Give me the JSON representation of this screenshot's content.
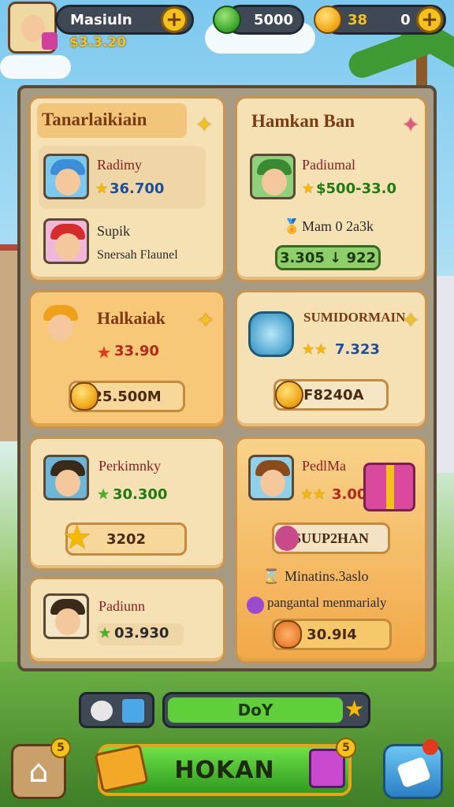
{
  "topbar": {
    "player_name": "Masiuln",
    "player_coins": "$3.3.20",
    "gems": "5000",
    "coins": "38",
    "coins_extra": "0"
  },
  "cards": {
    "c1": {
      "title": "Tanarlaikiain",
      "row1_name": "Radimy",
      "row1_value": "36.700",
      "row2_name": "Supik",
      "row2_desc": "Snersah Flaunel"
    },
    "c2": {
      "title": "Hamkan Ban",
      "row1_name": "Padiumal",
      "row1_value": "$500-33.0",
      "sub_label": "Mam 0 2a3k",
      "bar_value": "3.305 ↓ 922"
    },
    "c3": {
      "title": "Halkaiak",
      "value": "33.90",
      "bar_value": "25.500M"
    },
    "c4": {
      "title": "SUMIDORMAIN",
      "value": "7.323",
      "bar_value": "IF8240A"
    },
    "c5": {
      "title": "Perkimnky",
      "value": "30.300",
      "bar_value": "3202"
    },
    "c6": {
      "title": "PedlMa",
      "value": "3.00",
      "badge_label": "SUUP2HAN",
      "line1": "Minatins.3aslo",
      "line2": "pangantal menmarialy",
      "bar_value": "30.9I4"
    },
    "c7": {
      "title": "Padiunn",
      "value": "03.930"
    }
  },
  "bottom": {
    "day_label": "DoY",
    "main_button": "HOKAN",
    "badge_left": "5",
    "badge_right": "5"
  },
  "colors": {
    "accent": "#f5c21b",
    "green": "#3fb52a",
    "panel": "#f6e1b4"
  }
}
